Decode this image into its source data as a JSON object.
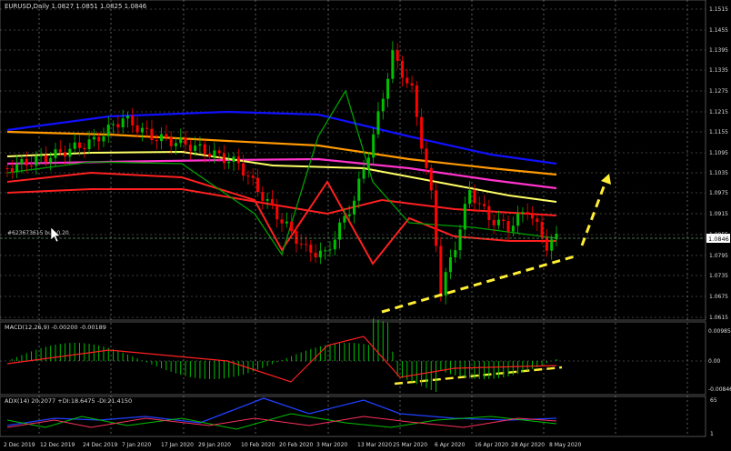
{
  "main_panel": {
    "title": "EURUSD,Daily  1.0827 1.0851 1.0825 1.0846",
    "order_label": "#623673615 buy 0.20",
    "current_price": "1.0846",
    "price_ticks": [
      "1.1515",
      "1.1455",
      "1.1395",
      "1.1335",
      "1.1275",
      "1.1215",
      "1.1155",
      "1.1095",
      "1.1035",
      "1.0975",
      "1.0915",
      "1.0855",
      "1.0795",
      "1.0735",
      "1.0675",
      "1.0615"
    ]
  },
  "macd_panel": {
    "title": "MACD(12,26,9) -0.00200 -0.00189",
    "ticks": [
      "0.00985",
      "0.00",
      "-0.00846"
    ]
  },
  "adx_panel": {
    "title": "ADX(14) 20.2077 +DI:18.6475 -DI:21.4150",
    "ticks": [
      "65",
      "1"
    ]
  },
  "date_labels": [
    "2 Dec 2019",
    "12 Dec 2019",
    "24 Dec 2019",
    "7 Jan 2020",
    "17 Jan 2020",
    "29 Jan 2020",
    "10 Feb 2020",
    "20 Feb 2020",
    "3 Mar 2020",
    "13 Mar 2020",
    "25 Mar 2020",
    "6 Apr 2020",
    "16 Apr 2020",
    "28 Apr 2020",
    "8 May 2020"
  ],
  "colors": {
    "background": "#000000",
    "grid": "#9a9a9a",
    "bull_candle": "#00c000",
    "bear_candle": "#ff0000",
    "ma_blue": "#1010ff",
    "ma_orange": "#ff9900",
    "ma_magenta": "#ff33cc",
    "ma_yellow": "#ffff66",
    "ma_red": "#ff2020",
    "trend_dashed": "#ffee33",
    "price_marker_bg": "#ffffff"
  }
}
